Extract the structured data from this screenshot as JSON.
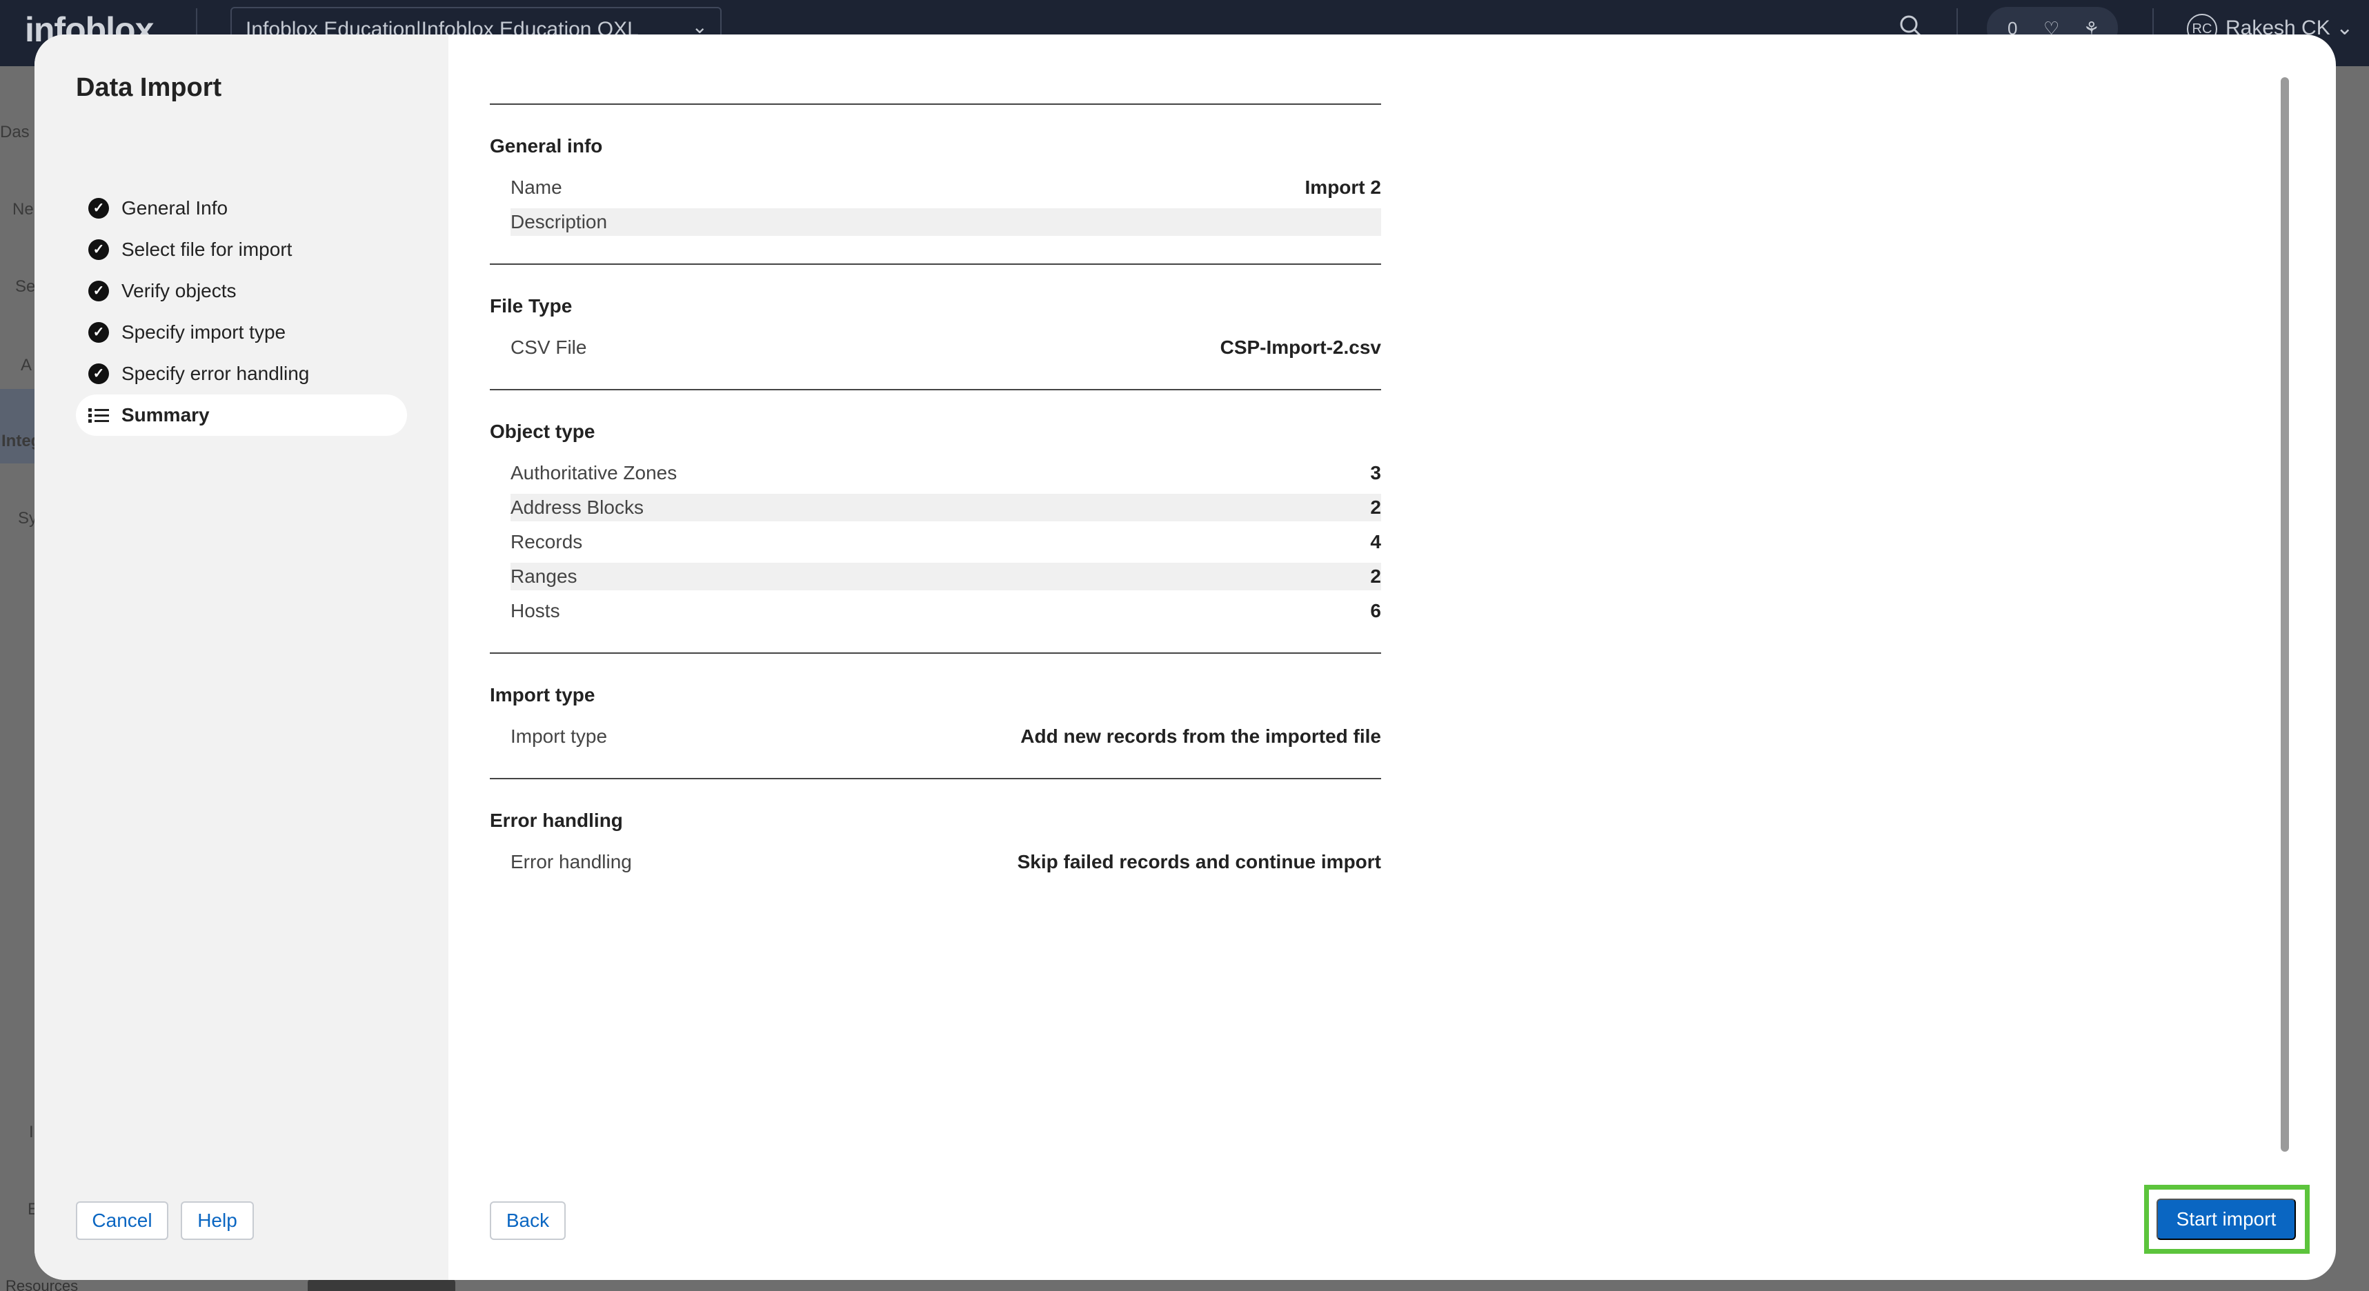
{
  "background": {
    "logo": "infoblox",
    "org_selector": "Infoblox Education|Infoblox Education OXL",
    "notification_count": "0",
    "user_initials": "RC",
    "user_name": "Rakesh CK",
    "nav_fragments": [
      "Das",
      "Ne",
      "Se",
      "A",
      "Integ",
      "Sy",
      "I",
      "E"
    ],
    "footer_fragment": "Resources"
  },
  "modal": {
    "title": "Data Import",
    "steps": [
      {
        "label": "General Info",
        "status": "complete",
        "icon": "check-circle-icon"
      },
      {
        "label": "Select file for import",
        "status": "complete",
        "icon": "check-circle-icon"
      },
      {
        "label": "Verify objects",
        "status": "complete",
        "icon": "check-circle-icon"
      },
      {
        "label": "Specify import type",
        "status": "complete",
        "icon": "check-circle-icon"
      },
      {
        "label": "Specify error handling",
        "status": "complete",
        "icon": "check-circle-icon"
      },
      {
        "label": "Summary",
        "status": "active",
        "icon": "list-icon"
      }
    ],
    "cancel_label": "Cancel",
    "help_label": "Help",
    "back_label": "Back",
    "start_import_label": "Start import"
  },
  "summary": {
    "general_info": {
      "title": "General info",
      "rows": [
        {
          "key": "Name",
          "value": "Import 2"
        },
        {
          "key": "Description",
          "value": ""
        }
      ]
    },
    "file_type": {
      "title": "File Type",
      "rows": [
        {
          "key": "CSV File",
          "value": "CSP-Import-2.csv"
        }
      ]
    },
    "object_type": {
      "title": "Object type",
      "rows": [
        {
          "key": "Authoritative Zones",
          "value": "3"
        },
        {
          "key": "Address Blocks",
          "value": "2"
        },
        {
          "key": "Records",
          "value": "4"
        },
        {
          "key": "Ranges",
          "value": "2"
        },
        {
          "key": "Hosts",
          "value": "6"
        }
      ]
    },
    "import_type": {
      "title": "Import type",
      "rows": [
        {
          "key": "Import type",
          "value": "Add new records from the imported file"
        }
      ]
    },
    "error_handling": {
      "title": "Error handling",
      "rows": [
        {
          "key": "Error handling",
          "value": "Skip failed records and continue import"
        }
      ]
    }
  },
  "colors": {
    "primary": "#0a66c2",
    "highlight": "#5cc43c",
    "topbar": "#1c2333"
  }
}
